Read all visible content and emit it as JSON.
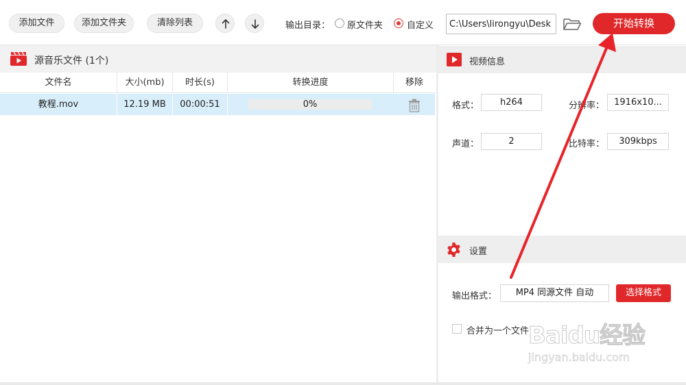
{
  "toolbar": {
    "add_file": "添加文件",
    "add_folder": "添加文件夹",
    "clear_list": "清除列表",
    "output_dir_label": "输出目录：",
    "radio_original": "原文件夹",
    "radio_custom": "自定义",
    "output_path": "C:\\Users\\lirongyu\\Desk",
    "start": "开始转换"
  },
  "source_panel": {
    "title": "源音乐文件 (1个)",
    "columns": [
      "文件名",
      "大小(mb)",
      "时长(s)",
      "转换进度",
      "移除"
    ],
    "rows": [
      {
        "name": "教程.mov",
        "size": "12.19 MB",
        "duration": "00:00:51",
        "progress": "0%",
        "progress_value": 0
      }
    ]
  },
  "video_info": {
    "title": "视频信息",
    "format_label": "格式：",
    "format_value": "h264",
    "resolution_label": "分辨率：",
    "resolution_value": "1916x10...",
    "channels_label": "声道：",
    "channels_value": "2",
    "bitrate_label": "比特率：",
    "bitrate_value": "309kbps"
  },
  "settings": {
    "title": "设置",
    "output_format_label": "输出格式：",
    "output_format_value": "MP4 同源文件 自动",
    "select_format": "选择格式",
    "merge_label": "合并为一个文件"
  },
  "watermark": {
    "brand": "Baidu经验",
    "url": "jingyan.baidu.com"
  },
  "colors": {
    "accent": "#e0282a",
    "row_selected": "#d8eefa",
    "panel_header": "#f2f2f2"
  }
}
